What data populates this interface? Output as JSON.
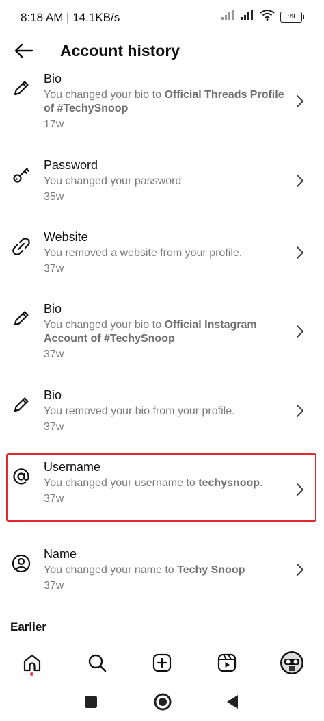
{
  "status_bar": {
    "time_speed": "8:18 AM | 14.1KB/s",
    "battery": "89",
    "icons": [
      "signal-icon",
      "signal-icon",
      "wifi-icon",
      "battery-icon"
    ]
  },
  "header": {
    "title": "Account history",
    "back_icon": "arrow-left-icon"
  },
  "items": [
    {
      "title": "Bio",
      "desc_prefix": "You changed your bio to ",
      "desc_bold": "Official Threads Profile of #TechySnoop",
      "desc_suffix": "",
      "time": "17w",
      "icon": "pencil-icon",
      "highlighted": false
    },
    {
      "title": "Password",
      "desc_prefix": "You changed your password",
      "desc_bold": "",
      "desc_suffix": "",
      "time": "35w",
      "icon": "key-icon",
      "highlighted": false
    },
    {
      "title": "Website",
      "desc_prefix": "You removed a website from your profile.",
      "desc_bold": "",
      "desc_suffix": "",
      "time": "37w",
      "icon": "link-icon",
      "highlighted": false
    },
    {
      "title": "Bio",
      "desc_prefix": "You changed your bio to ",
      "desc_bold": "Official Instagram Account of #TechySnoop",
      "desc_suffix": "",
      "time": "37w",
      "icon": "pencil-icon",
      "highlighted": false
    },
    {
      "title": "Bio",
      "desc_prefix": "You removed your bio from your profile.",
      "desc_bold": "",
      "desc_suffix": "",
      "time": "37w",
      "icon": "pencil-icon",
      "highlighted": false
    },
    {
      "title": "Username",
      "desc_prefix": "You changed your username to ",
      "desc_bold": "techysnoop",
      "desc_suffix": ".",
      "time": "37w",
      "icon": "at-sign-icon",
      "highlighted": true
    },
    {
      "title": "Name",
      "desc_prefix": "You changed your name to ",
      "desc_bold": "Techy Snoop",
      "desc_suffix": "",
      "time": "37w",
      "icon": "user-circle-icon",
      "highlighted": false
    }
  ],
  "section": {
    "earlier_label": "Earlier"
  },
  "tab_bar": {
    "tabs": [
      "home-icon",
      "search-icon",
      "create-icon",
      "reels-icon",
      "profile-avatar"
    ]
  },
  "system_nav": [
    "recents-square-icon",
    "home-circle-icon",
    "back-triangle-icon"
  ],
  "colors": {
    "highlight": "#e0292e",
    "notification_dot": "#ff2d55",
    "secondary_text": "#7a7a7a"
  }
}
